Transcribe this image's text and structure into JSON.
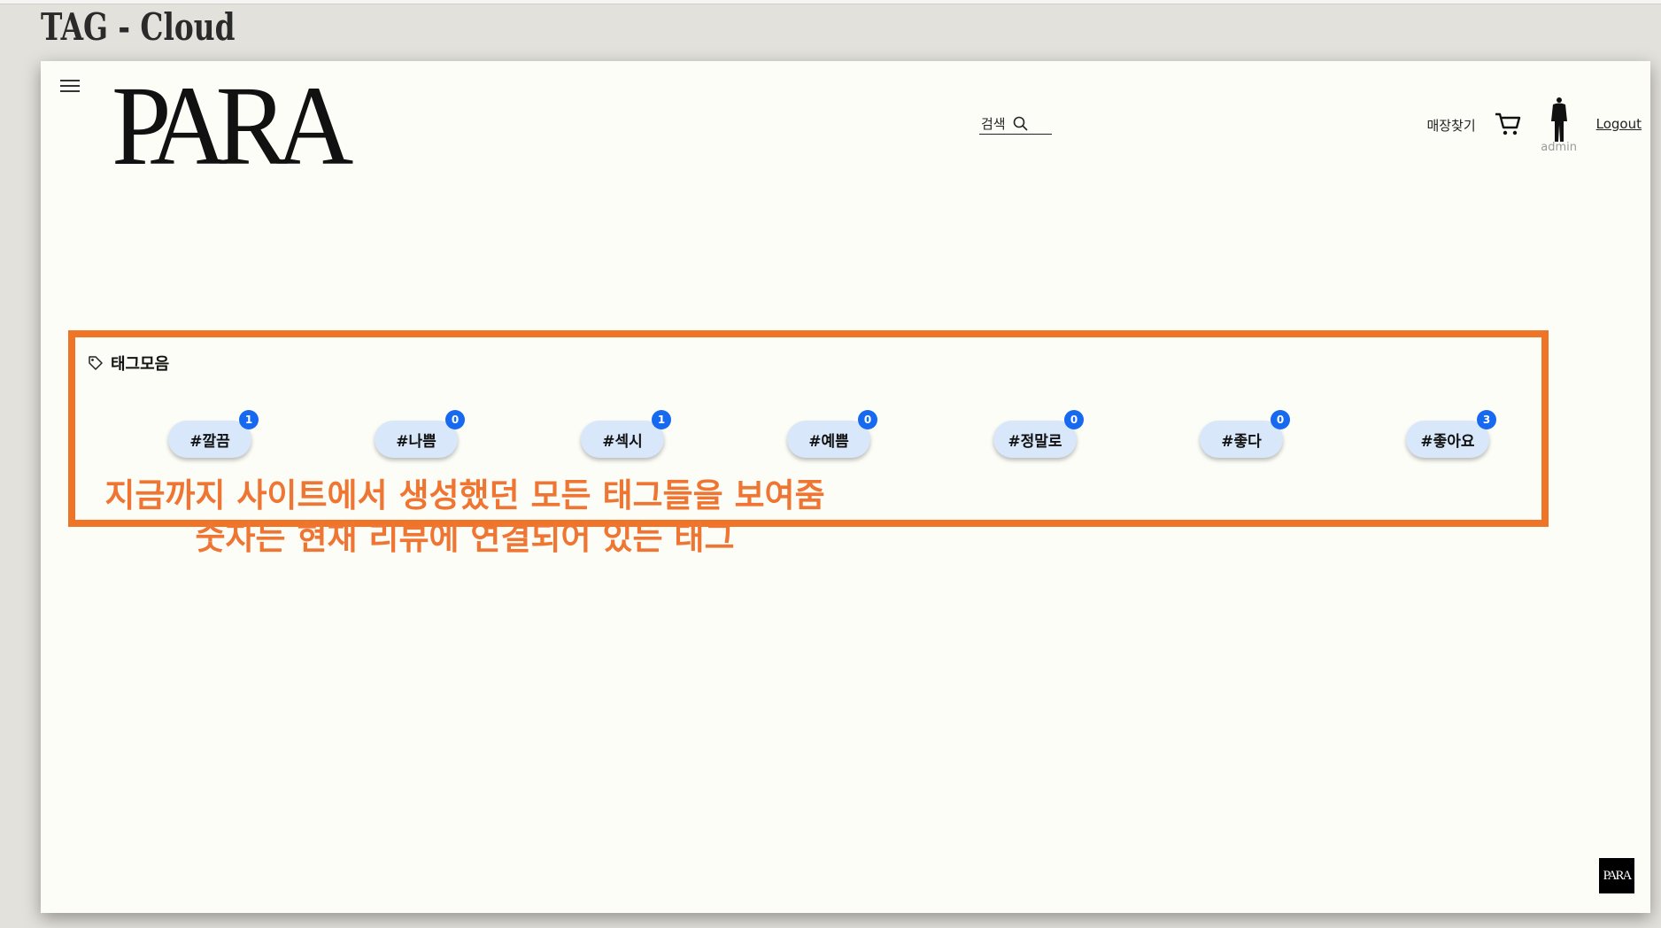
{
  "slide": {
    "title": "TAG - Cloud"
  },
  "header": {
    "logo": "PARA",
    "search_label": "검색",
    "store_finder": "매장찾기",
    "profile_name": "admin",
    "logout": "Logout"
  },
  "tag_cloud": {
    "title": "태그모음",
    "tags": [
      {
        "label": "#깔끔",
        "count": "1"
      },
      {
        "label": "#나쁨",
        "count": "0"
      },
      {
        "label": "#섹시",
        "count": "1"
      },
      {
        "label": "#예쁨",
        "count": "0"
      },
      {
        "label": "#정말로",
        "count": "0"
      },
      {
        "label": "#좋다",
        "count": "0"
      },
      {
        "label": "#좋아요",
        "count": "3"
      }
    ]
  },
  "annotation": {
    "line1": "지금까지 사이트에서 생성했던 모든 태그들을 보여줌",
    "line2": "숫자는 현재 리뷰에 연결되어 있는 태그"
  },
  "footer": {
    "logo": "PARA"
  },
  "colors": {
    "accent_orange": "#f07427",
    "badge_blue": "#1769f0",
    "chip_bg": "#d9e7fa"
  },
  "icons": {
    "menu": "hamburger-icon",
    "search": "search-icon",
    "cart": "cart-icon",
    "tag": "tag-icon",
    "profile": "avatar"
  }
}
